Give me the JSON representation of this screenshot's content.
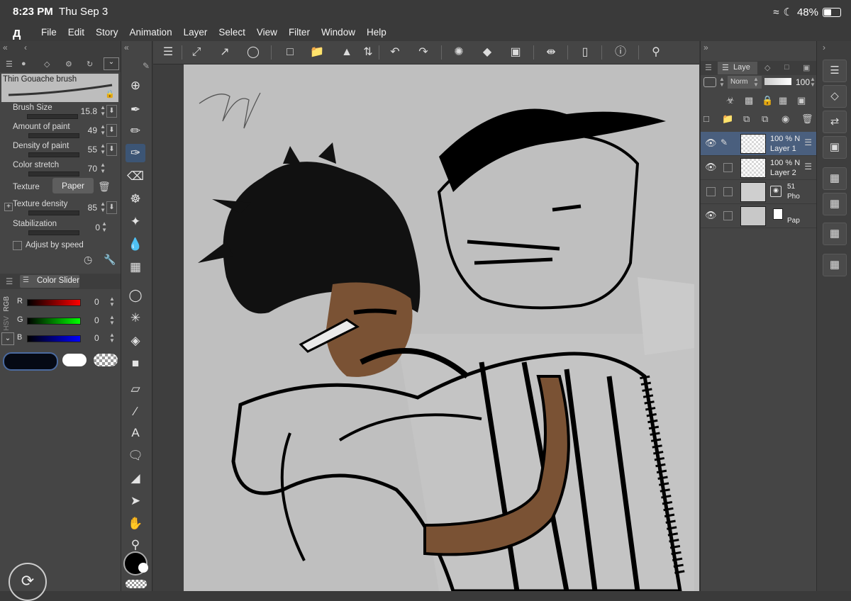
{
  "status": {
    "time": "8:23 PM",
    "date": "Thu Sep 3",
    "battery": "48%"
  },
  "menu": {
    "items": [
      "File",
      "Edit",
      "Story",
      "Animation",
      "Layer",
      "Select",
      "View",
      "Filter",
      "Window",
      "Help"
    ]
  },
  "brush": {
    "name": "Thin Gouache brush",
    "params": [
      {
        "label": "Brush Size",
        "value": "15.8"
      },
      {
        "label": "Amount of paint",
        "value": "49"
      },
      {
        "label": "Density of paint",
        "value": "55"
      },
      {
        "label": "Color stretch",
        "value": "70"
      }
    ],
    "texture_label": "Texture",
    "texture_value": "Paper",
    "texture_density_label": "Texture density",
    "texture_density_value": "85",
    "stabilization_label": "Stabilization",
    "stabilization_value": "0",
    "adjust_label": "Adjust by speed"
  },
  "color_slider": {
    "title": "Color Slider",
    "mode_rgb": "RGB",
    "mode_hsv": "HSV",
    "channels": [
      {
        "label": "R",
        "value": "0"
      },
      {
        "label": "G",
        "value": "0"
      },
      {
        "label": "B",
        "value": "0"
      }
    ]
  },
  "layers_panel": {
    "tab": "Laye",
    "blend": "Norm",
    "opacity": "100",
    "layers": [
      {
        "opacity": "100 %",
        "blend": "N",
        "name": "Layer 1"
      },
      {
        "opacity": "100 %",
        "blend": "N",
        "name": "Layer 2"
      },
      {
        "opacity": "51",
        "name": "Pho"
      },
      {
        "name": "Pap"
      }
    ]
  }
}
